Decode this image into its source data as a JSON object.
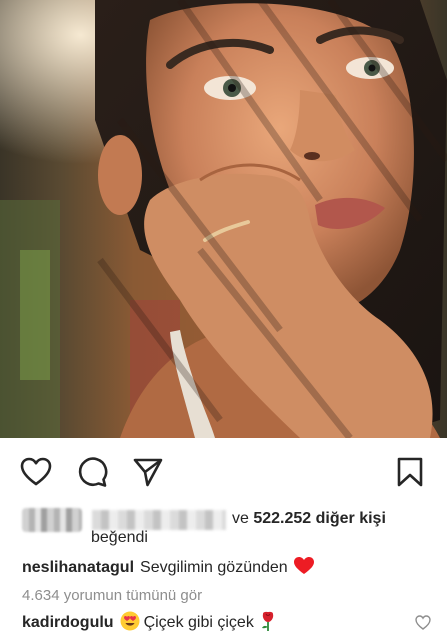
{
  "post": {
    "image_alt": "Portrait photo",
    "actions": {
      "like_icon": "heart-outline-icon",
      "comment_icon": "comment-bubble-icon",
      "share_icon": "send-paper-plane-icon",
      "save_icon": "bookmark-icon"
    },
    "likes": {
      "middle": "ve",
      "count": "522.252 diğer kişi",
      "suffix": "beğendi"
    },
    "caption": {
      "username": "neslihanatagul",
      "text": "Sevgilimin gözünden",
      "emoji": "red-heart"
    },
    "view_all_comments": "4.634 yorumun tümünü gör",
    "comment": {
      "username": "kadirdogulu",
      "emoji": "heart-eyes",
      "text": "Çiçek gibi çiçek",
      "trailing_emoji": "rose"
    }
  },
  "colors": {
    "text": "#262626",
    "muted": "#8e8e8e",
    "heart_red": "#ed4956"
  }
}
